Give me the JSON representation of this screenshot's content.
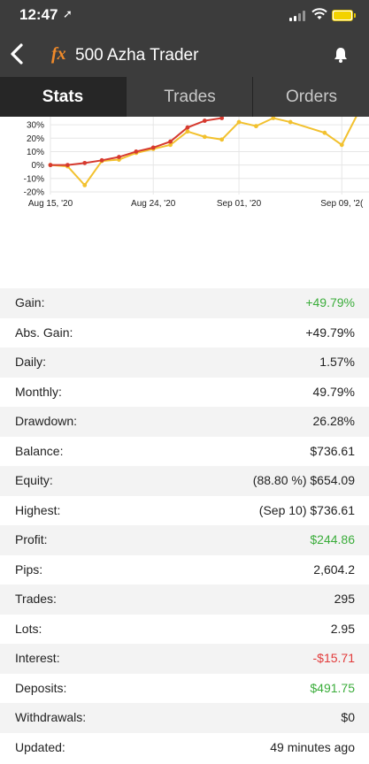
{
  "status_bar": {
    "time": "12:47",
    "location_glyph": "➚"
  },
  "header": {
    "logo_text": "fx",
    "title": "500 Azha Trader",
    "back_icon": "chevron-left-icon",
    "bell_icon": "bell-icon"
  },
  "tabs": [
    {
      "label": "Stats",
      "active": true
    },
    {
      "label": "Trades",
      "active": false
    },
    {
      "label": "Orders",
      "active": false
    }
  ],
  "chart_data": {
    "type": "line",
    "x": [
      "Aug 15, '20",
      "Aug 17, '20",
      "Aug 19, '20",
      "Aug 21, '20",
      "Aug 22, '20",
      "Aug 24, '20",
      "Aug 25, '20",
      "Aug 27, '20",
      "Aug 28, '20",
      "Aug 30, '20",
      "Sep 01, '20",
      "Sep 02, '20",
      "Sep 03, '20",
      "Sep 04, '20",
      "Sep 05, '20",
      "Sep 06, '20",
      "Sep 07, '20",
      "Sep 08, '20",
      "Sep 09, '20",
      "Sep 10, '20"
    ],
    "series": [
      {
        "color": "#d63a2f",
        "values": [
          0,
          0,
          1.5,
          3.5,
          6,
          10,
          13,
          17.5,
          28,
          33,
          35,
          null,
          null,
          null,
          null,
          null,
          null,
          null,
          null,
          null
        ]
      },
      {
        "color": "#f2c12e",
        "values": [
          0,
          -1,
          -15,
          3,
          4,
          9,
          12,
          15,
          25,
          21,
          19,
          32,
          29,
          35,
          32,
          null,
          24,
          15,
          40,
          45
        ]
      }
    ],
    "ytick_labels": [
      "-20%",
      "-10%",
      "0%",
      "10%",
      "20%",
      "30%"
    ],
    "xtick_labels": [
      "Aug 15, '20",
      "Aug 24, '20",
      "Sep 01, '20",
      "Sep 09, '2("
    ],
    "ylim": [
      -22,
      36
    ],
    "grid": true
  },
  "stats": [
    {
      "label": "Gain:",
      "value": "+49.79%",
      "tone": "green"
    },
    {
      "label": "Abs. Gain:",
      "value": "+49.79%",
      "tone": ""
    },
    {
      "label": "Daily:",
      "value": "1.57%",
      "tone": ""
    },
    {
      "label": "Monthly:",
      "value": "49.79%",
      "tone": ""
    },
    {
      "label": "Drawdown:",
      "value": "26.28%",
      "tone": ""
    },
    {
      "label": "Balance:",
      "value": "$736.61",
      "tone": ""
    },
    {
      "label": "Equity:",
      "value": "(88.80 %) $654.09",
      "tone": ""
    },
    {
      "label": "Highest:",
      "value": "(Sep 10) $736.61",
      "tone": ""
    },
    {
      "label": "Profit:",
      "value": "$244.86",
      "tone": "green"
    },
    {
      "label": "Pips:",
      "value": "2,604.2",
      "tone": ""
    },
    {
      "label": "Trades:",
      "value": "295",
      "tone": ""
    },
    {
      "label": "Lots:",
      "value": "2.95",
      "tone": ""
    },
    {
      "label": "Interest:",
      "value": "-$15.71",
      "tone": "red"
    },
    {
      "label": "Deposits:",
      "value": "$491.75",
      "tone": "green"
    },
    {
      "label": "Withdrawals:",
      "value": "$0",
      "tone": ""
    },
    {
      "label": "Updated:",
      "value": "49 minutes ago",
      "tone": ""
    }
  ]
}
